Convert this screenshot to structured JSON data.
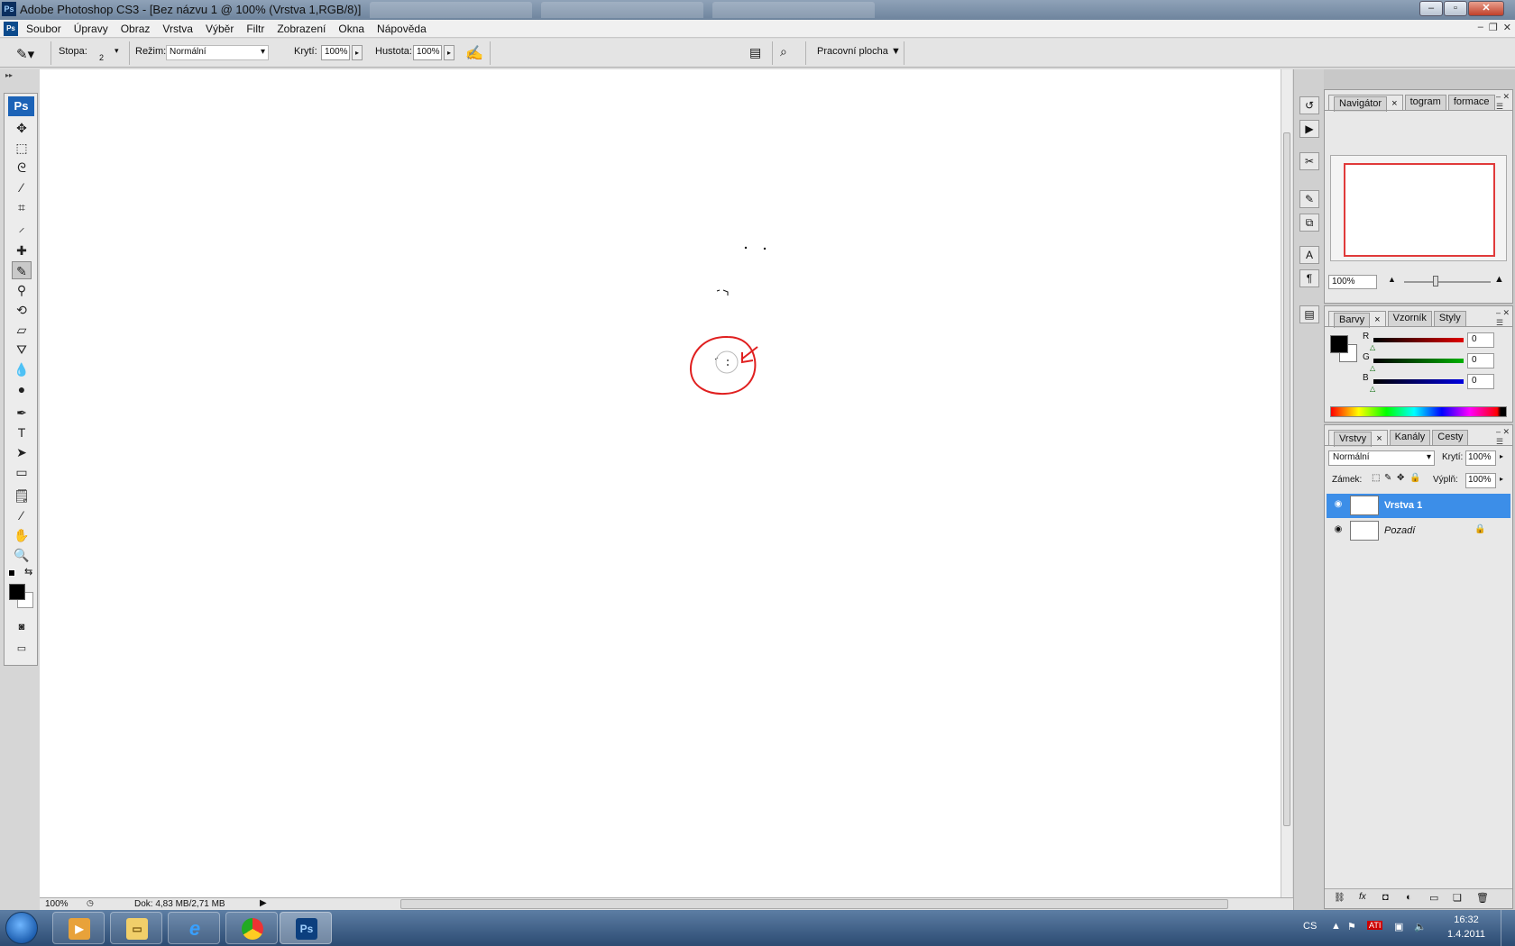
{
  "window": {
    "title": "Adobe Photoshop CS3 - [Bez názvu 1 @ 100% (Vrstva 1,RGB/8)]"
  },
  "menu": [
    "Soubor",
    "Úpravy",
    "Obraz",
    "Vrstva",
    "Výběr",
    "Filtr",
    "Zobrazení",
    "Okna",
    "Nápověda"
  ],
  "options": {
    "stopa_label": "Stopa:",
    "stopa_value": "2",
    "rezim_label": "Režim:",
    "rezim_value": "Normální",
    "kryti_label": "Krytí:",
    "kryti_value": "100%",
    "hustota_label": "Hustota:",
    "hustota_value": "100%",
    "workspace_label": "Pracovní plocha"
  },
  "toolbox": {
    "badge": "Ps"
  },
  "status": {
    "zoom": "100%",
    "doc": "Dok: 4,83 MB/2,71 MB"
  },
  "navigator": {
    "tabs": [
      "Navigátor",
      "togram",
      "formace"
    ],
    "zoom": "100%"
  },
  "color": {
    "tabs": [
      "Barvy",
      "Vzorník",
      "Styly"
    ],
    "r_label": "R",
    "g_label": "G",
    "b_label": "B",
    "r_value": "0",
    "g_value": "0",
    "b_value": "0",
    "r_color": "#e00000",
    "g_color": "#00b000",
    "b_color": "#0000e0"
  },
  "layers": {
    "tabs": [
      "Vrstvy",
      "Kanály",
      "Cesty"
    ],
    "blend_mode": "Normální",
    "kryti_label": "Krytí:",
    "kryti_value": "100%",
    "lock_label": "Zámek:",
    "fill_label": "Výplň:",
    "fill_value": "100%",
    "items": [
      {
        "name": "Vrstva 1",
        "selected": true
      },
      {
        "name": "Pozadí",
        "selected": false
      }
    ]
  },
  "taskbar": {
    "lang": "CS",
    "time": "16:32",
    "date": "1.4.2011",
    "ps_label": "Ps"
  },
  "annotation_color": "#e02020",
  "accent_color": "#3c8ee8"
}
